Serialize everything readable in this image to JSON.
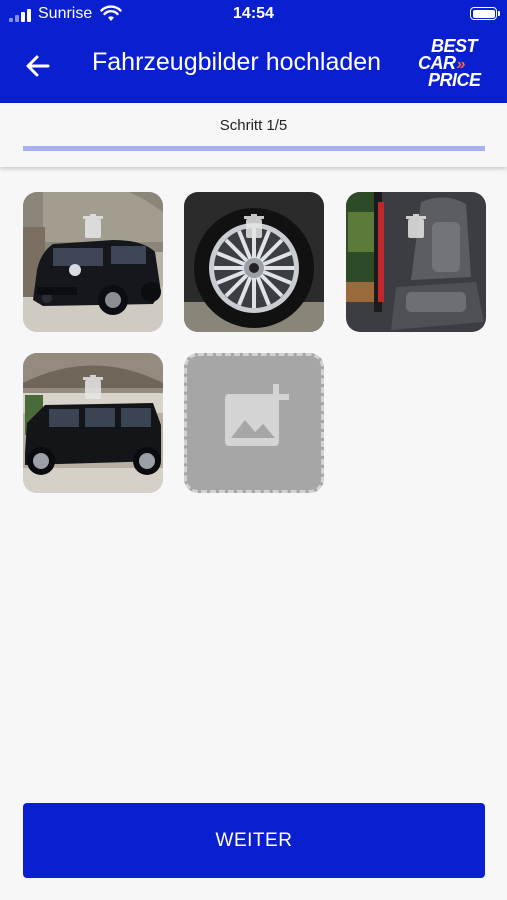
{
  "status_bar": {
    "carrier": "Sunrise",
    "time": "14:54"
  },
  "header": {
    "title": "Fahrzeugbilder hochladen",
    "logo_line1": "BEST",
    "logo_line2": "CAR",
    "logo_chevrons": "»",
    "logo_line3": "PRICE"
  },
  "step": {
    "label": "Schritt 1/5",
    "progress": 0.2
  },
  "photos": [
    {
      "icon": "car-front-photo"
    },
    {
      "icon": "wheel-photo"
    },
    {
      "icon": "seat-photo"
    },
    {
      "icon": "car-side-photo"
    }
  ],
  "actions": {
    "continue_label": "WEITER"
  },
  "colors": {
    "primary": "#0a1fcf",
    "progress": "#a7b1ee",
    "logo_accent": "#ff6a3d"
  }
}
